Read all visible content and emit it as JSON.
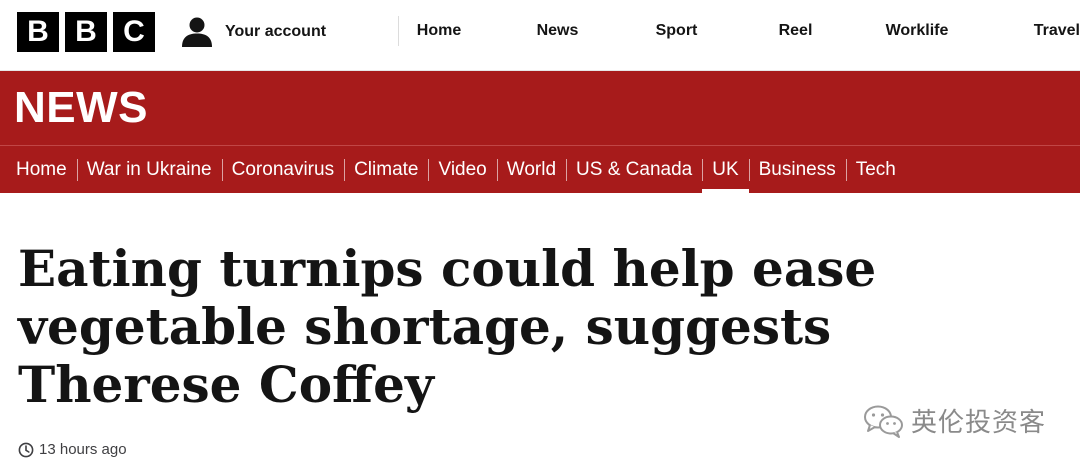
{
  "brand": {
    "logo_letters": [
      "B",
      "B",
      "C"
    ]
  },
  "account": {
    "label": "Your account",
    "icon": "person-icon"
  },
  "top_nav": {
    "items": [
      {
        "label": "Home"
      },
      {
        "label": "News"
      },
      {
        "label": "Sport"
      },
      {
        "label": "Reel"
      },
      {
        "label": "Worklife"
      },
      {
        "label": "Travel"
      }
    ]
  },
  "news_band": {
    "wordmark": "NEWS",
    "color": "#a71b1b"
  },
  "section_nav": {
    "active": "UK",
    "items": [
      {
        "label": "Home"
      },
      {
        "label": "War in Ukraine"
      },
      {
        "label": "Coronavirus"
      },
      {
        "label": "Climate"
      },
      {
        "label": "Video"
      },
      {
        "label": "World"
      },
      {
        "label": "US & Canada"
      },
      {
        "label": "UK"
      },
      {
        "label": "Business"
      },
      {
        "label": "Tech"
      }
    ]
  },
  "article": {
    "headline": "Eating turnips could help ease vegetable shortage, suggests Therese Coffey",
    "timestamp": "13 hours ago",
    "timestamp_icon": "clock-icon"
  },
  "watermark": {
    "text": "英伦投资客",
    "icon": "wechat-icon"
  }
}
